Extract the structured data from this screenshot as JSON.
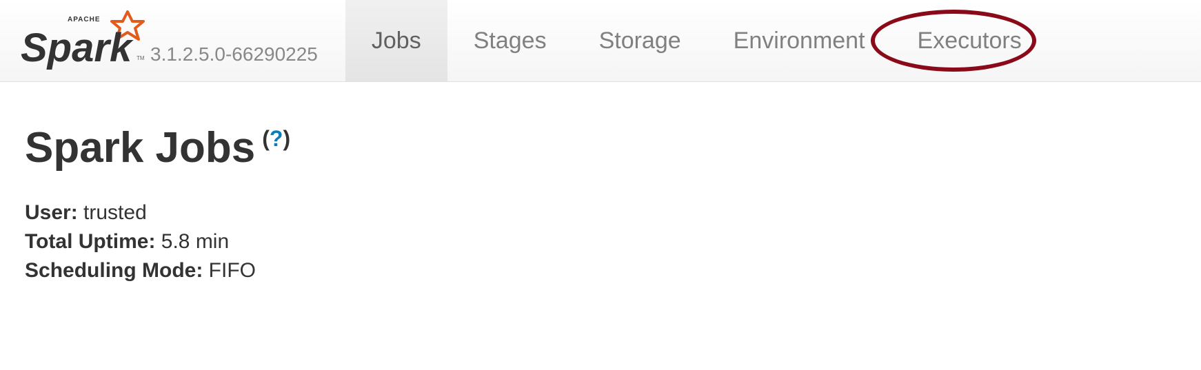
{
  "header": {
    "version": "3.1.2.5.0-66290225"
  },
  "nav": {
    "tabs": [
      {
        "label": "Jobs",
        "active": true,
        "highlighted": false
      },
      {
        "label": "Stages",
        "active": false,
        "highlighted": false
      },
      {
        "label": "Storage",
        "active": false,
        "highlighted": false
      },
      {
        "label": "Environment",
        "active": false,
        "highlighted": false
      },
      {
        "label": "Executors",
        "active": false,
        "highlighted": true
      }
    ]
  },
  "page": {
    "title": "Spark Jobs",
    "help_symbol": "?",
    "info": [
      {
        "label": "User:",
        "value": "trusted"
      },
      {
        "label": "Total Uptime:",
        "value": "5.8 min"
      },
      {
        "label": "Scheduling Mode:",
        "value": "FIFO"
      }
    ]
  }
}
